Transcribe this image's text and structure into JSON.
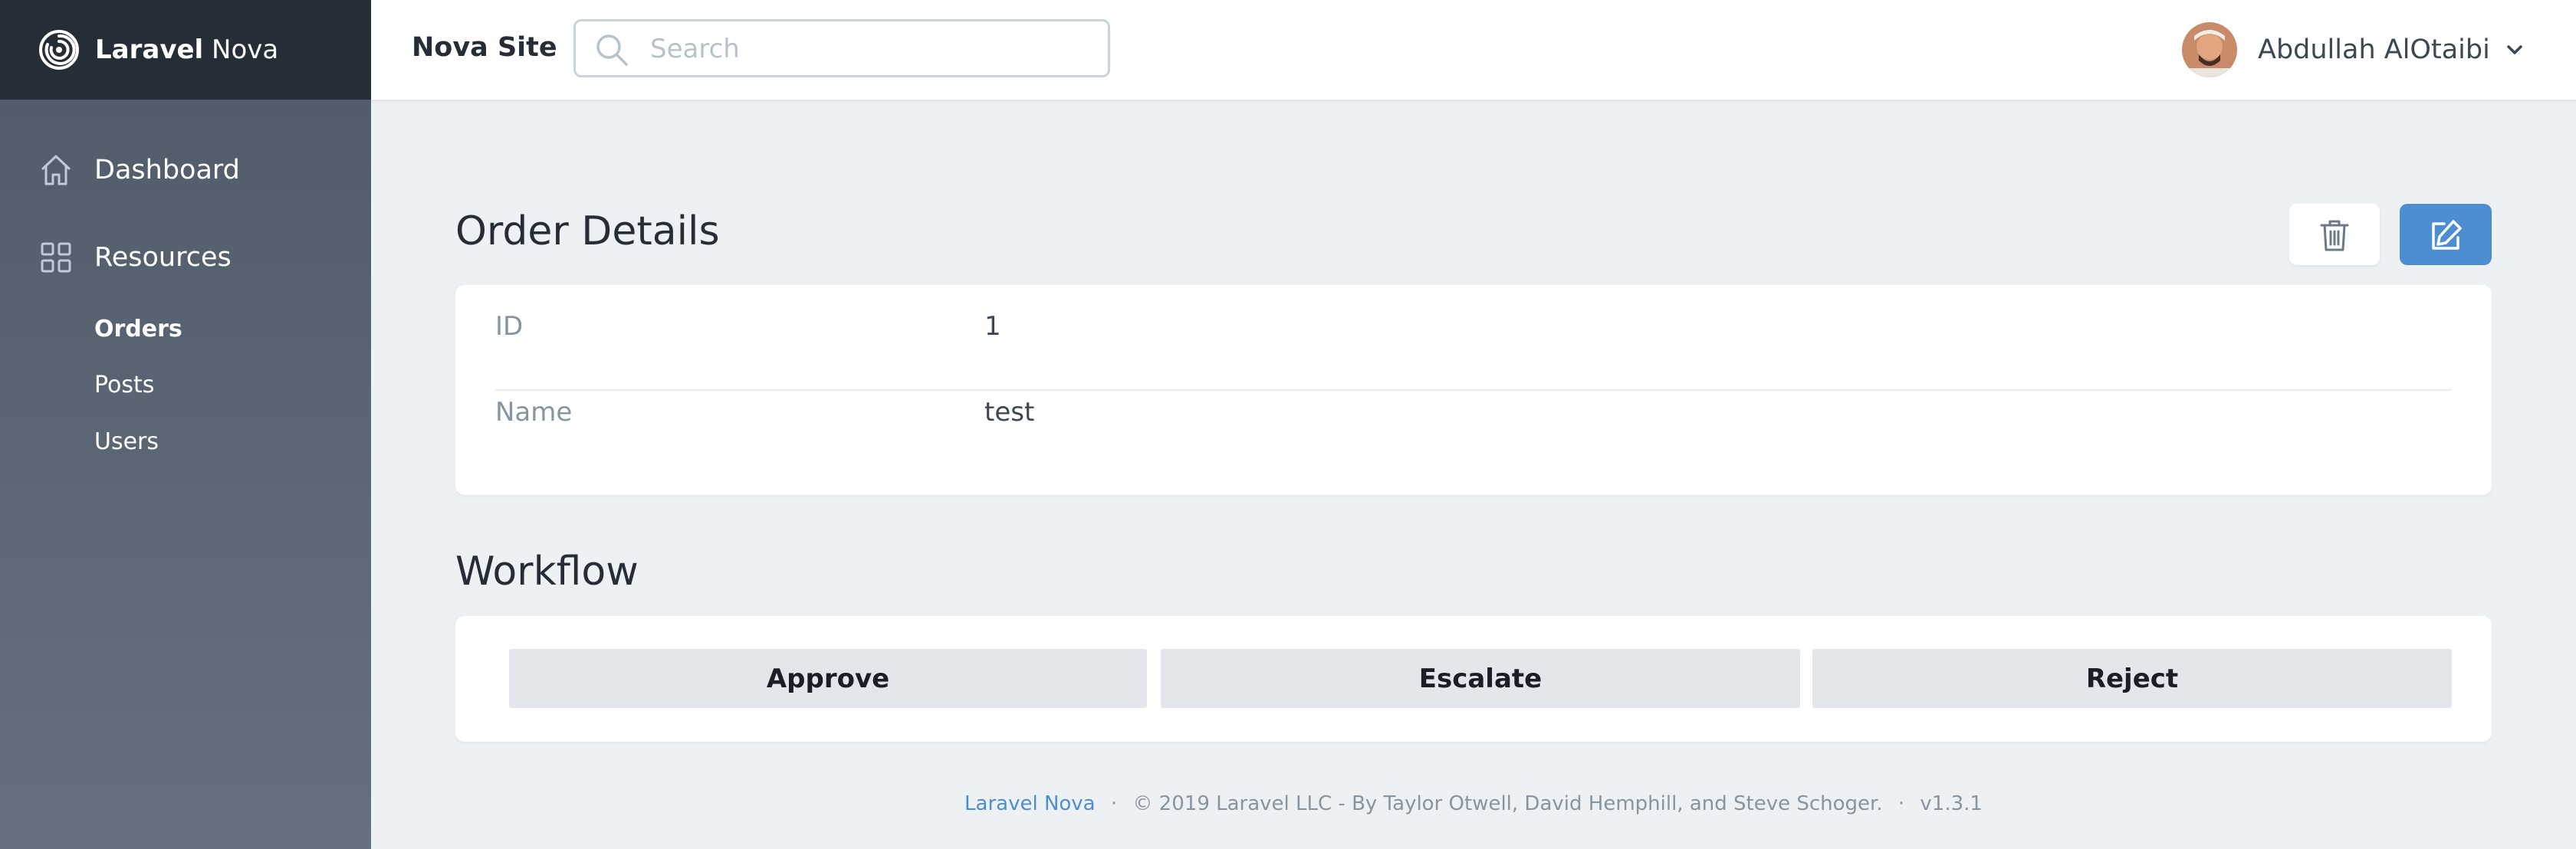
{
  "brand": {
    "name_bold": "Laravel",
    "name_rest": " Nova"
  },
  "sidebar": {
    "items": [
      {
        "label": "Dashboard",
        "icon": "home-icon"
      },
      {
        "label": "Resources",
        "icon": "grid-icon"
      }
    ],
    "resources": [
      {
        "label": "Orders",
        "active": true
      },
      {
        "label": "Posts",
        "active": false
      },
      {
        "label": "Users",
        "active": false
      }
    ]
  },
  "header": {
    "site_title": "Nova Site",
    "search_placeholder": "Search",
    "user_name": "Abdullah AlOtaibi"
  },
  "detail": {
    "title": "Order Details",
    "fields": [
      {
        "key": "ID",
        "value": "1"
      },
      {
        "key": "Name",
        "value": "test"
      }
    ]
  },
  "workflow": {
    "title": "Workflow",
    "actions": [
      "Approve",
      "Escalate",
      "Reject"
    ]
  },
  "footer": {
    "link": "Laravel Nova",
    "sep": "·",
    "copyright": "© 2019 Laravel LLC - By Taylor Otwell, David Hemphill, and Steve Schoger.",
    "version": "v1.3.1"
  },
  "colors": {
    "primary": "#4d8ed1",
    "sidebar_top": "#252d37",
    "background": "#eef1f4"
  }
}
